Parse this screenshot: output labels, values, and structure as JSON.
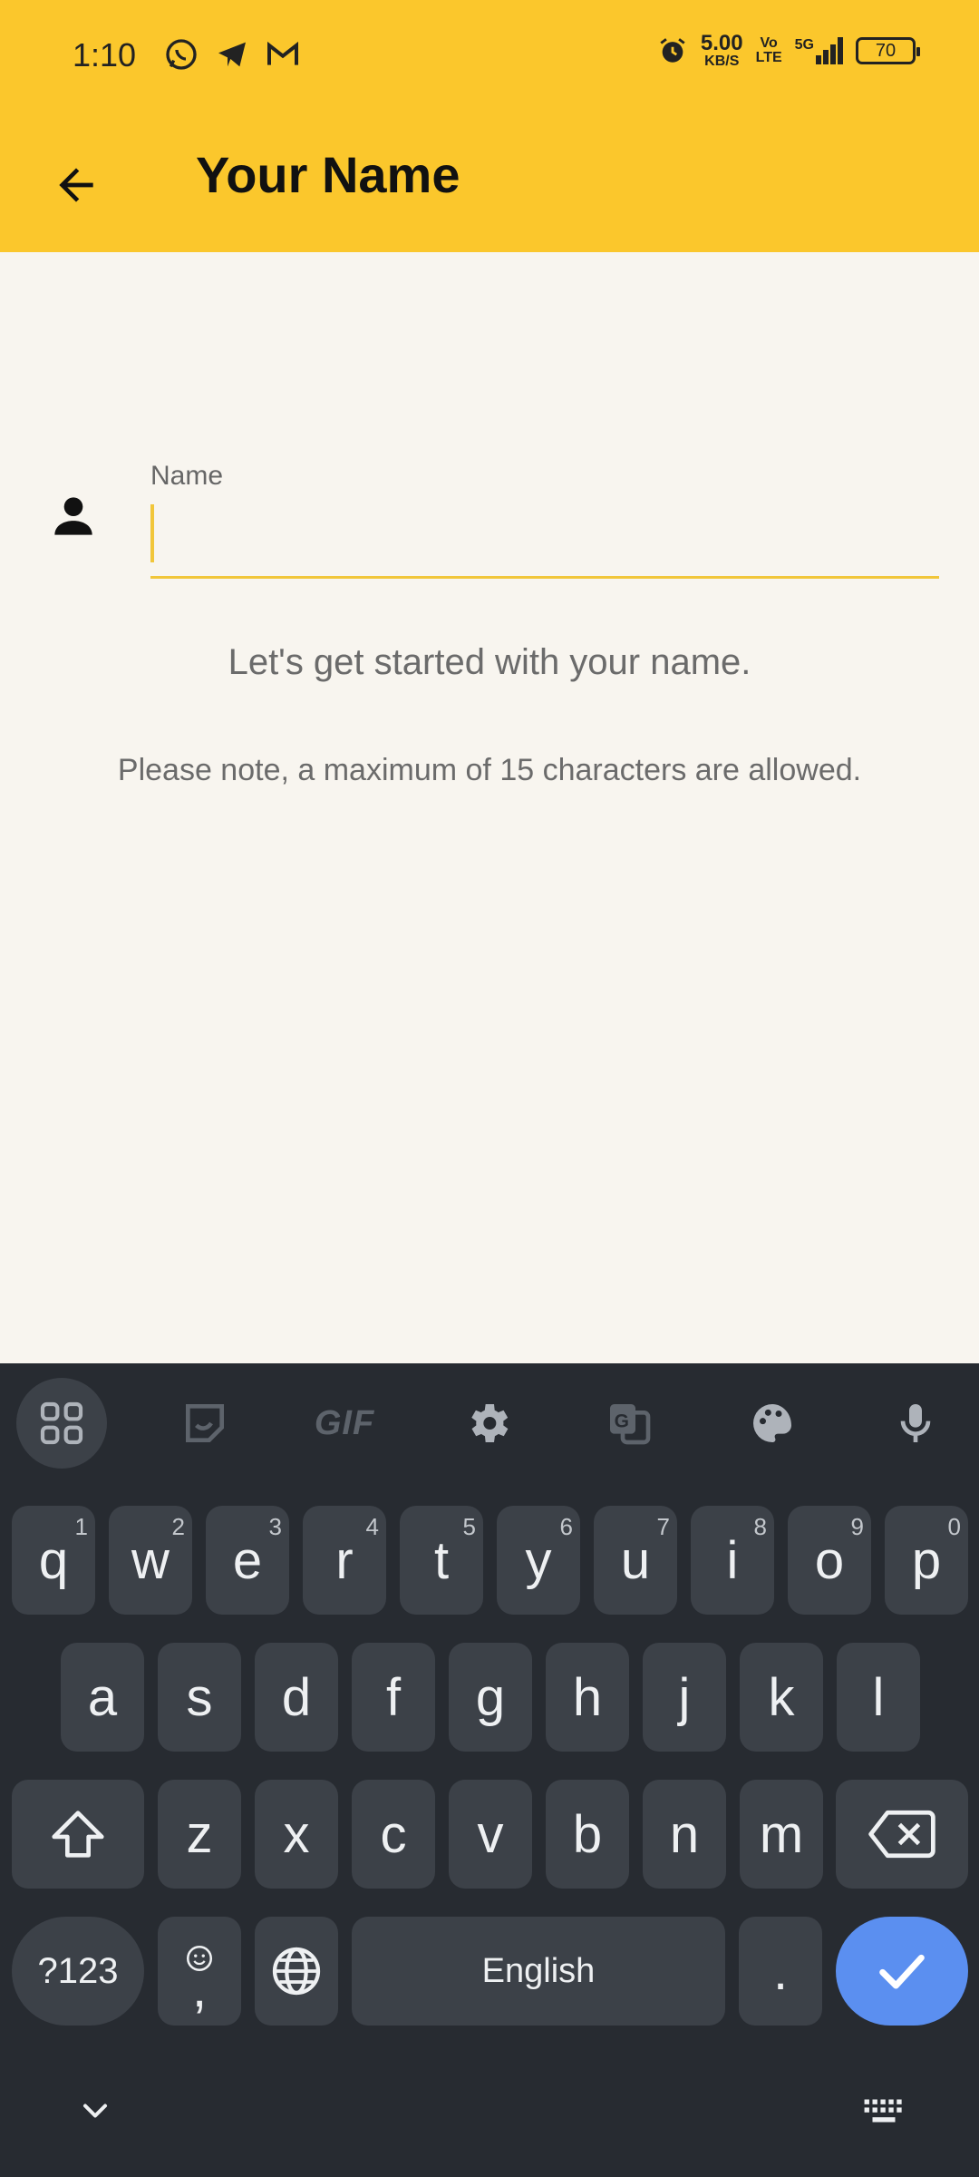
{
  "status": {
    "time": "1:10",
    "net_speed_value": "5.00",
    "net_speed_unit": "KB/S",
    "volte_top": "Vo",
    "volte_bottom": "LTE",
    "network": "5G",
    "battery": "70"
  },
  "app_bar": {
    "title": "Your Name"
  },
  "form": {
    "label": "Name",
    "value": "",
    "hint_primary": "Let's get started with your name.",
    "hint_secondary": "Please note, a maximum of 15 characters are allowed."
  },
  "keyboard": {
    "row1": [
      {
        "key": "q",
        "hint": "1"
      },
      {
        "key": "w",
        "hint": "2"
      },
      {
        "key": "e",
        "hint": "3"
      },
      {
        "key": "r",
        "hint": "4"
      },
      {
        "key": "t",
        "hint": "5"
      },
      {
        "key": "y",
        "hint": "6"
      },
      {
        "key": "u",
        "hint": "7"
      },
      {
        "key": "i",
        "hint": "8"
      },
      {
        "key": "o",
        "hint": "9"
      },
      {
        "key": "p",
        "hint": "0"
      }
    ],
    "row2": [
      "a",
      "s",
      "d",
      "f",
      "g",
      "h",
      "j",
      "k",
      "l"
    ],
    "row3": [
      "z",
      "x",
      "c",
      "v",
      "b",
      "n",
      "m"
    ],
    "symbols_label": "?123",
    "comma_label": ",",
    "space_label": "English",
    "period_label": ".",
    "gif_label": "GIF"
  },
  "colors": {
    "accent": "#fbc72c",
    "background": "#f8f5ef",
    "keyboard_bg": "#272b31",
    "key_bg": "#3c4148",
    "enter_bg": "#5b8ff0"
  }
}
